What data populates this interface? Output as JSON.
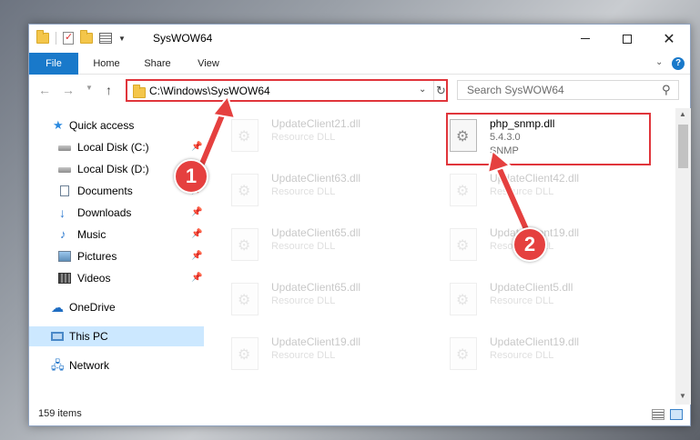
{
  "window": {
    "title": "SysWOW64",
    "minimize_icon": "minimize-icon",
    "maximize_icon": "maximize-icon",
    "close_glyph": "✕"
  },
  "ribbon": {
    "tabs": [
      {
        "label": "File"
      },
      {
        "label": "Home"
      },
      {
        "label": "Share"
      },
      {
        "label": "View"
      }
    ],
    "help_glyph": "?"
  },
  "nav": {
    "back_glyph": "←",
    "forward_glyph": "→",
    "recent_glyph": "▼",
    "up_glyph": "↑",
    "address": "C:\\Windows\\SysWOW64",
    "address_chevron": "⌄",
    "refresh_glyph": "↻",
    "search_placeholder": "Search SysWOW64",
    "search_glyph": "⚲"
  },
  "sidebar": {
    "items": [
      {
        "label": "Quick access",
        "icon": "star-icon"
      },
      {
        "label": "Local Disk (C:)",
        "icon": "disk-icon",
        "pinned": true
      },
      {
        "label": "Local Disk (D:)",
        "icon": "disk-icon",
        "pinned": false
      },
      {
        "label": "Documents",
        "icon": "documents-icon",
        "pinned": true
      },
      {
        "label": "Downloads",
        "icon": "downloads-icon",
        "pinned": true
      },
      {
        "label": "Music",
        "icon": "music-icon",
        "pinned": true
      },
      {
        "label": "Pictures",
        "icon": "pictures-icon",
        "pinned": true
      },
      {
        "label": "Videos",
        "icon": "videos-icon",
        "pinned": true
      },
      {
        "label": "OneDrive",
        "icon": "onedrive-icon"
      },
      {
        "label": "This PC",
        "icon": "this-pc-icon",
        "selected": true
      },
      {
        "label": "Network",
        "icon": "network-icon"
      }
    ],
    "pin_glyph": "📌"
  },
  "files": {
    "left_column": [
      {
        "name": "UpdateClient21.dll",
        "type": "Resource DLL"
      },
      {
        "name": "UpdateClient63.dll",
        "type": "Resource DLL"
      },
      {
        "name": "UpdateClient65.dll",
        "type": "Resource DLL"
      },
      {
        "name": "UpdateClient65.dll",
        "type": "Resource DLL"
      },
      {
        "name": "UpdateClient19.dll",
        "type": "Resource DLL"
      }
    ],
    "highlighted": {
      "name": "php_snmp.dll",
      "version": "5.4.3.0",
      "description": "SNMP"
    },
    "right_column": [
      {
        "name": "UpdateClient42.dll",
        "type": "Resource DLL"
      },
      {
        "name": "UpdateClient19.dll",
        "type": "Resource DLL"
      },
      {
        "name": "UpdateClient5.dll",
        "type": "Resource DLL"
      },
      {
        "name": "UpdateClient19.dll",
        "type": "Resource DLL"
      }
    ]
  },
  "scrollbar": {
    "up_glyph": "▲",
    "down_glyph": "▼"
  },
  "status": {
    "item_count": "159 items"
  },
  "annotations": [
    {
      "label": "1",
      "color": "#e5403f"
    },
    {
      "label": "2",
      "color": "#e5403f"
    }
  ],
  "colors": {
    "accent": "#1979ca",
    "highlight": "#e0353b",
    "selection": "#cce8ff"
  }
}
